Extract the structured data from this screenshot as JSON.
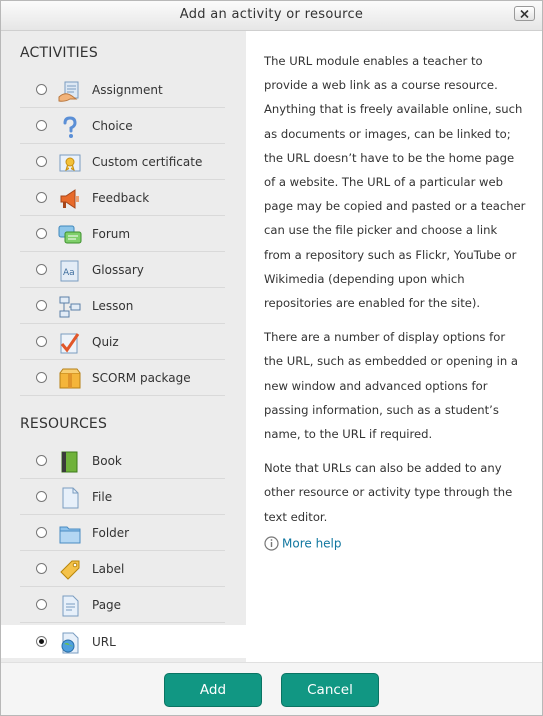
{
  "dialog": {
    "title": "Add an activity or resource"
  },
  "activities": {
    "heading": "ACTIVITIES",
    "items": [
      {
        "label": "Assignment",
        "icon": "assignment-icon"
      },
      {
        "label": "Choice",
        "icon": "choice-icon"
      },
      {
        "label": "Custom certificate",
        "icon": "certificate-icon"
      },
      {
        "label": "Feedback",
        "icon": "feedback-icon"
      },
      {
        "label": "Forum",
        "icon": "forum-icon"
      },
      {
        "label": "Glossary",
        "icon": "glossary-icon"
      },
      {
        "label": "Lesson",
        "icon": "lesson-icon"
      },
      {
        "label": "Quiz",
        "icon": "quiz-icon"
      },
      {
        "label": "SCORM package",
        "icon": "scorm-icon"
      }
    ]
  },
  "resources": {
    "heading": "RESOURCES",
    "items": [
      {
        "label": "Book",
        "icon": "book-icon"
      },
      {
        "label": "File",
        "icon": "file-icon"
      },
      {
        "label": "Folder",
        "icon": "folder-icon"
      },
      {
        "label": "Label",
        "icon": "label-icon"
      },
      {
        "label": "Page",
        "icon": "page-icon"
      },
      {
        "label": "URL",
        "icon": "url-icon",
        "selected": true
      }
    ]
  },
  "description": {
    "paragraphs": [
      "The URL module enables a teacher to provide a web link as a course resource. Anything that is freely available online, such as documents or images, can be linked to; the URL doesn’t have to be the home page of a website. The URL of a particular web page may be copied and pasted or a teacher can use the file picker and choose a link from a repository such as Flickr, YouTube or Wikimedia (depending upon which repositories are enabled for the site).",
      "There are a number of display options for the URL, such as embedded or opening in a new window and advanced options for passing information, such as a student’s name, to the URL if required.",
      "Note that URLs can also be added to any other resource or activity type through the text editor."
    ],
    "more_help": "More help"
  },
  "footer": {
    "add_label": "Add",
    "cancel_label": "Cancel"
  },
  "colors": {
    "accent": "#119783",
    "link": "#1177a0",
    "panel": "#ececec"
  }
}
